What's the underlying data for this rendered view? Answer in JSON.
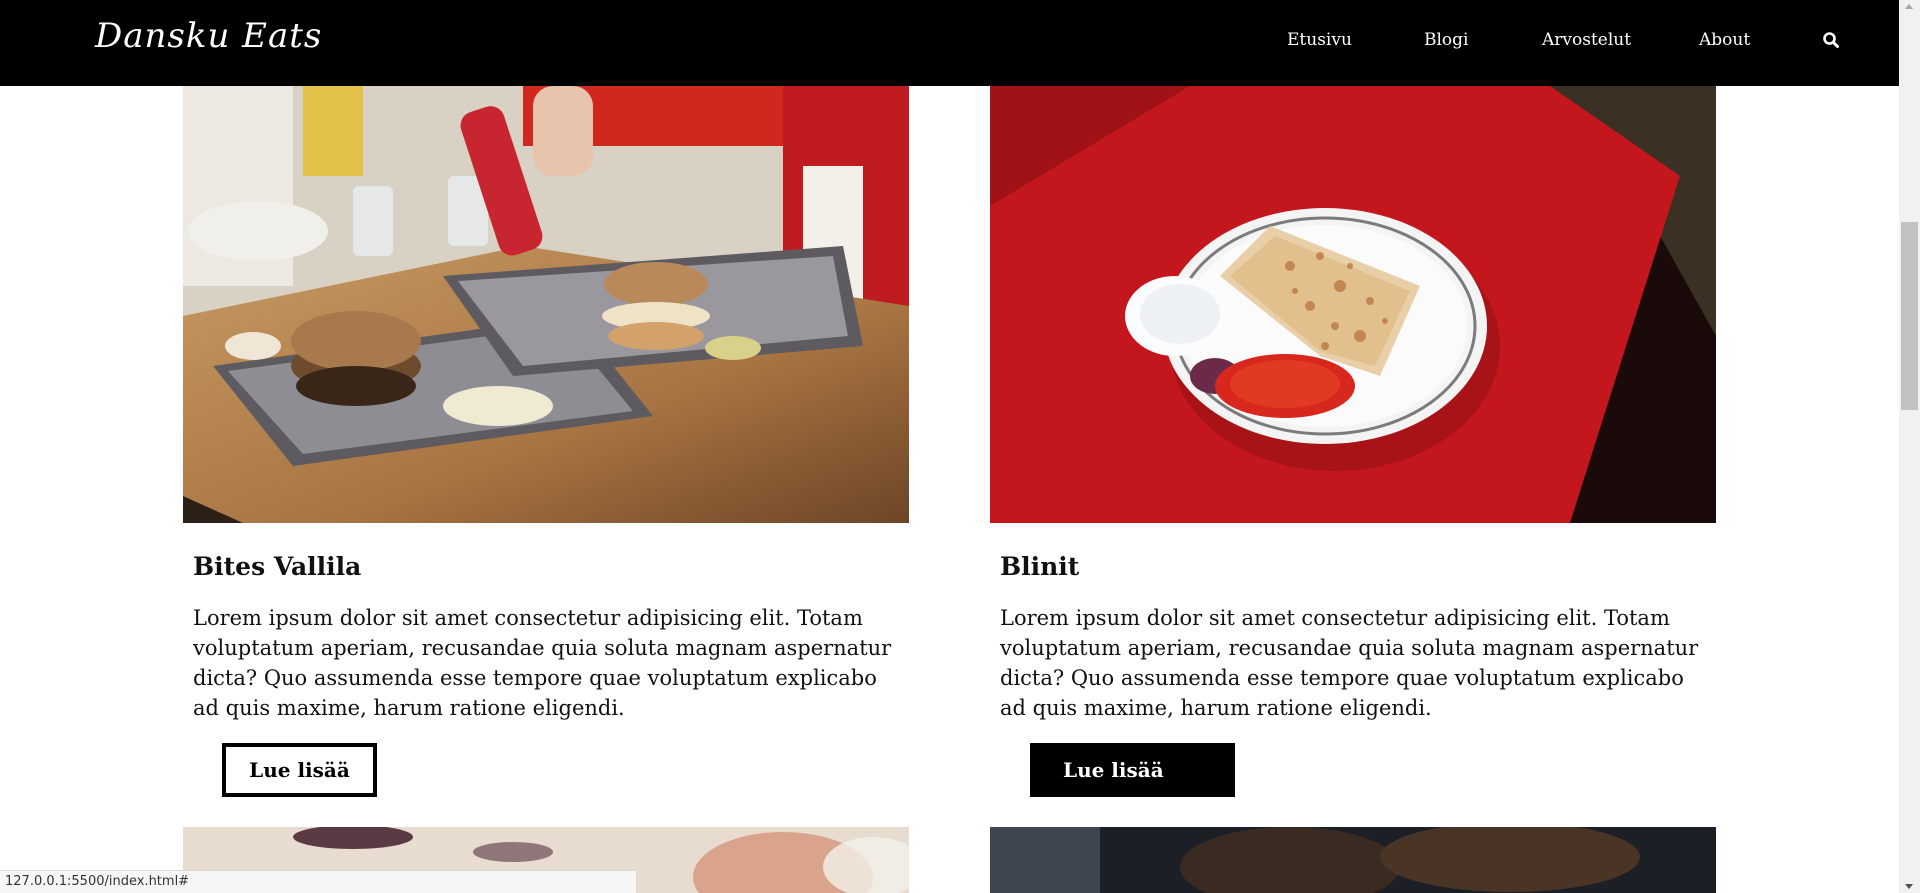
{
  "header": {
    "logo": "Dansku Eats",
    "nav": [
      "Etusivu",
      "Blogi",
      "Arvostelut",
      "About"
    ]
  },
  "cards": [
    {
      "title": "Bites Vallila",
      "text": "Lorem ipsum dolor sit amet consectetur adipisicing elit. Totam voluptatum aperiam, recusandae quia soluta magnam aspernatur dicta? Quo assumenda esse tempore quae voluptatum explicabo ad quis maxime, harum ratione eligendi.",
      "button": "Lue lisää"
    },
    {
      "title": "Blinit",
      "text": "Lorem ipsum dolor sit amet consectetur adipisicing elit. Totam voluptatum aperiam, recusandae quia soluta magnam aspernatur dicta? Quo assumenda esse tempore quae voluptatum explicabo ad quis maxime, harum ratione eligendi.",
      "button": "Lue lisää"
    }
  ],
  "statusbar": {
    "url": "127.0.0.1:5500/index.html#"
  },
  "colors": {
    "header_bg": "#000000",
    "page_bg": "#ffffff",
    "accent_red": "#c4171d"
  },
  "icons": {
    "search": "search-icon"
  }
}
